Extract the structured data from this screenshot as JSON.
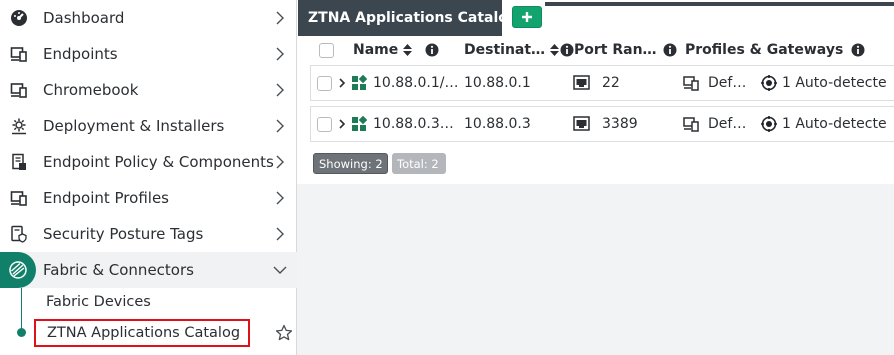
{
  "sidebar": {
    "items": [
      {
        "label": "Dashboard",
        "icon": "dashboard-gauge-icon"
      },
      {
        "label": "Endpoints",
        "icon": "endpoints-devices-icon"
      },
      {
        "label": "Chromebook",
        "icon": "chromebook-icon"
      },
      {
        "label": "Deployment & Installers",
        "icon": "deployment-gear-icon"
      },
      {
        "label": "Endpoint Policy & Components",
        "icon": "policy-document-icon"
      },
      {
        "label": "Endpoint Profiles",
        "icon": "profiles-devices-icon"
      },
      {
        "label": "Security Posture Tags",
        "icon": "posture-tag-icon"
      },
      {
        "label": "Fabric & Connectors",
        "icon": "fabric-icon"
      }
    ],
    "sub_items": [
      {
        "label": "Fabric Devices"
      },
      {
        "label": "ZTNA Applications Catalog"
      }
    ]
  },
  "tabs": {
    "active": "ZTNA Applications Catalog",
    "add_label": "+"
  },
  "table": {
    "headers": {
      "name": "Name",
      "destination": "Destinat…",
      "port": "Port Ran…",
      "profiles": "Profiles & Gateways"
    },
    "rows": [
      {
        "name": "10.88.0.1/…",
        "destination": "10.88.0.1",
        "port": "22",
        "profile": "Def…",
        "gateway": "1 Auto-detecte"
      },
      {
        "name": "10.88.0.3…",
        "destination": "10.88.0.3",
        "port": "3389",
        "profile": "Def…",
        "gateway": "1 Auto-detecte"
      }
    ],
    "showing": "Showing: 2",
    "total": "Total: 2"
  },
  "colors": {
    "accent": "#11806a",
    "tab_bg": "#3b464f",
    "add_button": "#13a36f",
    "highlight_border": "#e0101a"
  }
}
